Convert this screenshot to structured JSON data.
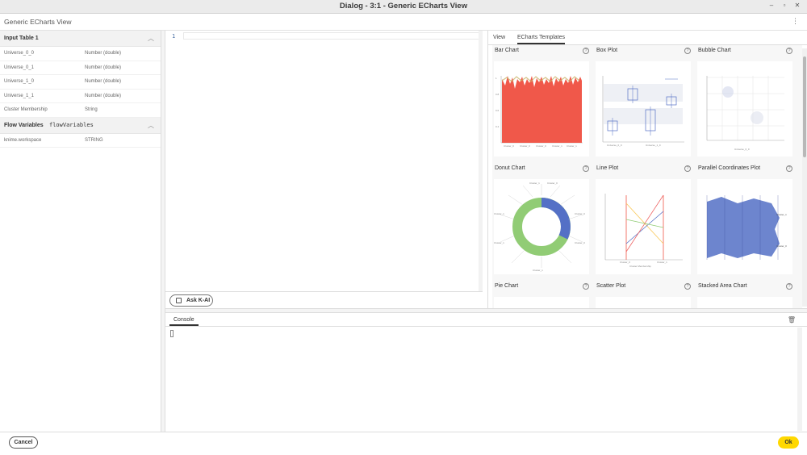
{
  "window": {
    "title": "Dialog - 3:1 - Generic ECharts View",
    "min": "–",
    "restore": "▫",
    "close": "✕"
  },
  "header": {
    "title": "Generic ECharts View",
    "menu": "⋮"
  },
  "left": {
    "input_table": {
      "title": "Input Table 1",
      "columns": [
        {
          "name": "Universe_0_0",
          "type": "Number (double)"
        },
        {
          "name": "Universe_0_1",
          "type": "Number (double)"
        },
        {
          "name": "Universe_1_0",
          "type": "Number (double)"
        },
        {
          "name": "Universe_1_1",
          "type": "Number (double)"
        },
        {
          "name": "Cluster Membership",
          "type": "String"
        }
      ]
    },
    "flow_variables": {
      "title": "Flow Variables",
      "code": "flowVariables",
      "items": [
        {
          "name": "knime.workspace",
          "type": "STRING"
        }
      ]
    }
  },
  "editor": {
    "line_number": "1"
  },
  "ask": {
    "label": "Ask K-AI"
  },
  "right": {
    "tabs": [
      {
        "label": "View",
        "active": false
      },
      {
        "label": "ECharts Templates",
        "active": true
      }
    ],
    "templates": [
      {
        "name": "Bar Chart"
      },
      {
        "name": "Box Plot"
      },
      {
        "name": "Bubble Chart"
      },
      {
        "name": "Donut Chart"
      },
      {
        "name": "Line Plot"
      },
      {
        "name": "Parallel Coordinates Plot"
      },
      {
        "name": "Pie Chart"
      },
      {
        "name": "Scatter Plot"
      },
      {
        "name": "Stacked Area Chart"
      }
    ],
    "help_glyph": "?"
  },
  "console": {
    "tab": "Console",
    "trash": "🗑"
  },
  "footer": {
    "cancel": "Cancel",
    "ok": "Ok"
  },
  "colors": {
    "accent": "#ffd800",
    "bar": "#f0584a",
    "donut_blue": "#5470c6",
    "donut_green": "#91cc75"
  }
}
